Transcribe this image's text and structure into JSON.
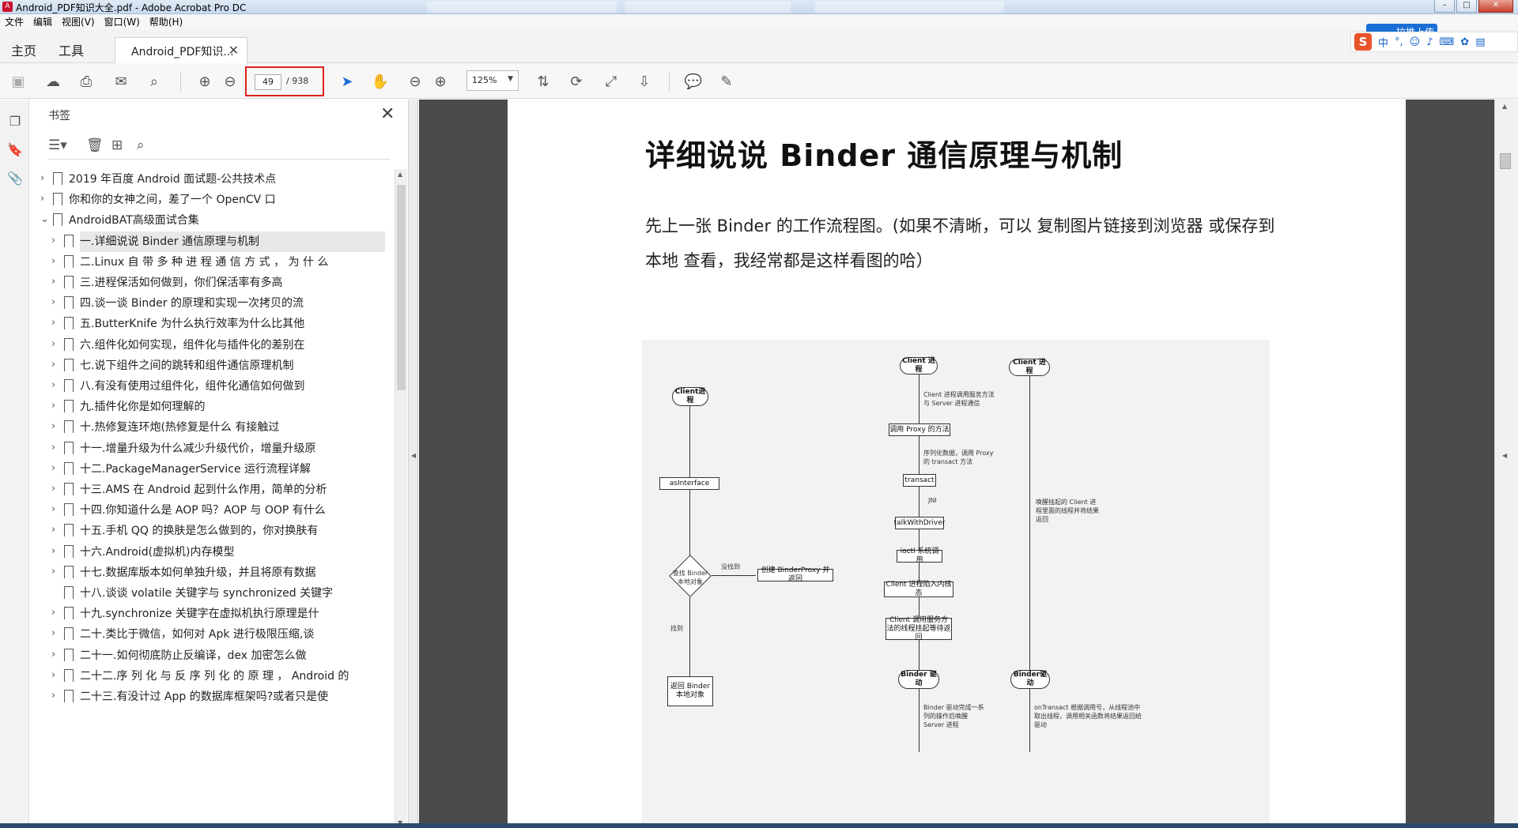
{
  "window": {
    "title": "Android_PDF知识大全.pdf - Adobe Acrobat Pro DC"
  },
  "menu": [
    "文件",
    "编辑",
    "视图(V)",
    "窗口(W)",
    "帮助(H)"
  ],
  "tabs": {
    "home": "主页",
    "tools": "工具",
    "document": "Android_PDF知识..."
  },
  "share": {
    "button": "拉推上传",
    "ime_logo": "S",
    "ime_mode": "中"
  },
  "toolbar": {
    "current_page": "49",
    "total_pages": "/ 938",
    "zoom": "125%"
  },
  "bookmarks": {
    "header": "书签",
    "items": [
      {
        "label": "2019 年百度 Android 面试题-公共技术点",
        "level": 0,
        "expanded": false,
        "has_children": true
      },
      {
        "label": "你和你的女神之间，差了一个 OpenCV 口",
        "level": 0,
        "expanded": false,
        "has_children": true
      },
      {
        "label": "AndroidBAT高级面试合集",
        "level": 0,
        "expanded": true,
        "has_children": true
      },
      {
        "label": "一.详细说说 Binder 通信原理与机制",
        "level": 1,
        "expanded": false,
        "has_children": true,
        "selected": true
      },
      {
        "label": "二.Linux 自 带 多 种 进 程 通 信 方 式 ， 为 什 么",
        "level": 1,
        "has_children": true
      },
      {
        "label": "三.进程保活如何做到，你们保活率有多高",
        "level": 1,
        "has_children": true
      },
      {
        "label": "四.谈一谈 Binder 的原理和实现一次拷贝的流",
        "level": 1,
        "has_children": true
      },
      {
        "label": "五.ButterKnife 为什么执行效率为什么比其他",
        "level": 1,
        "has_children": true
      },
      {
        "label": "六.组件化如何实现，组件化与插件化的差别在",
        "level": 1,
        "has_children": true
      },
      {
        "label": "七.说下组件之间的跳转和组件通信原理机制",
        "level": 1,
        "has_children": true
      },
      {
        "label": "八.有没有使用过组件化，组件化通信如何做到",
        "level": 1,
        "has_children": true
      },
      {
        "label": "九.插件化你是如何理解的",
        "level": 1,
        "has_children": true
      },
      {
        "label": "十.热修复连环炮(热修复是什么 有接触过",
        "level": 1,
        "has_children": true
      },
      {
        "label": "十一.增量升级为什么减少升级代价，增量升级原",
        "level": 1,
        "has_children": true
      },
      {
        "label": "十二.PackageManagerService 运行流程详解",
        "level": 1,
        "has_children": true
      },
      {
        "label": "十三.AMS 在 Android 起到什么作用，简单的分析",
        "level": 1,
        "has_children": true
      },
      {
        "label": "十四.你知道什么是 AOP 吗？AOP 与 OOP 有什么",
        "level": 1,
        "has_children": true
      },
      {
        "label": "十五.手机 QQ 的换肤是怎么做到的，你对换肤有",
        "level": 1,
        "has_children": true
      },
      {
        "label": "十六.Android(虚拟机)内存模型",
        "level": 1,
        "has_children": true
      },
      {
        "label": "十七.数据库版本如何单独升级，并且将原有数据",
        "level": 1,
        "has_children": true
      },
      {
        "label": "十八.谈谈 volatile 关键字与 synchronized 关键字",
        "level": 1,
        "has_children": false
      },
      {
        "label": "十九.synchronize 关键字在虚拟机执行原理是什",
        "level": 1,
        "has_children": true
      },
      {
        "label": "二十.类比于微信，如何对 Apk 进行极限压缩,谈",
        "level": 1,
        "has_children": true
      },
      {
        "label": "二十一.如何彻底防止反编译，dex 加密怎么做",
        "level": 1,
        "has_children": true
      },
      {
        "label": "二十二.序 列 化 与 反 序 列 化 的 原 理 ， Android 的",
        "level": 1,
        "has_children": true
      },
      {
        "label": "二十三.有没计过 App 的数据库框架吗?或者只是使",
        "level": 1,
        "has_children": true
      }
    ]
  },
  "document": {
    "title": "详细说说 Binder 通信原理与机制",
    "paragraph": "先上一张 Binder 的工作流程图。(如果不清晰，可以 复制图片链接到浏览器 或保存到本地 查看，我经常都是这样看图的哈）",
    "diagram": {
      "client_left": "Client进程",
      "asinterface": "asInterface",
      "find_binder": "查找 Binder 本地对象",
      "not_found": "没找到",
      "create_proxy": "创建 BinderProxy 并返回",
      "found": "找到",
      "return_binder": "返回 Binder 本地对象",
      "client_mid": "Client 进程",
      "call_note": "Client 进程调用服务方法与 Server 进程通信",
      "call_proxy": "调用 Proxy 的方法",
      "serialize_note": "序列化数据，调用 Proxy 的 transact 方法",
      "transact": "transact",
      "jni": "JNI",
      "talk_driver": "talkWithDriver",
      "ioctl": "ioctl 系统调用",
      "kernel": "Client 进程陷入内核态",
      "suspend": "Client 调用服务方法的线程挂起等待返回",
      "binder_driver_mid": "Binder 驱动",
      "driver_note": "Binder 驱动完成一系列的操作后唤醒 Server 进程",
      "client_right": "Client 进程",
      "wake_note": "唤醒挂起的 Client 进程里面的线程并将结果返回",
      "binder_driver_right": "Binder驱动",
      "ontransact_note": "onTransact 根据调用号，从线程池中取出线程，调用相关函数将结果返回给驱动"
    }
  }
}
